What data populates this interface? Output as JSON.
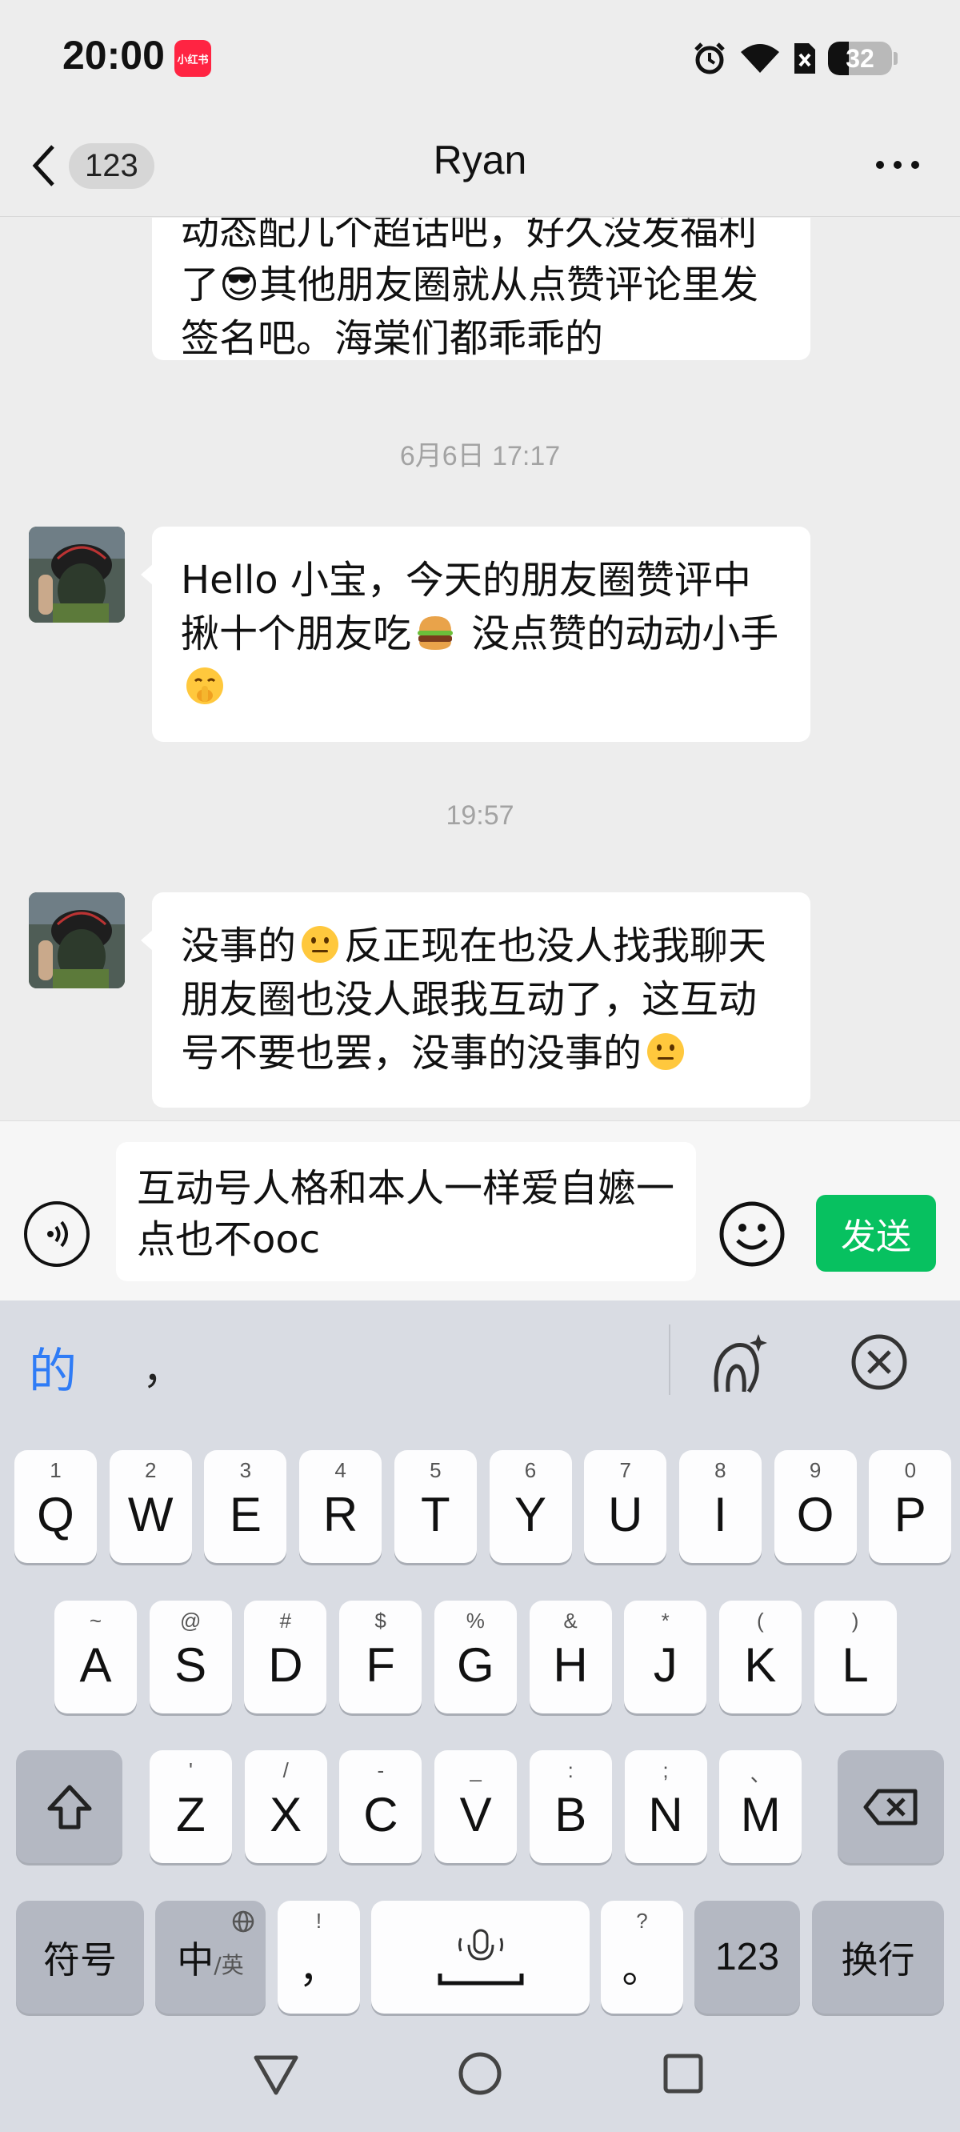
{
  "status_bar": {
    "time": "20:00",
    "app_badge": "小红书",
    "battery": "32",
    "battery_level": 0.32
  },
  "header": {
    "unread_count": "123",
    "title": "Ryan"
  },
  "messages": [
    {
      "type": "text",
      "lines": [
        "动态配几个超话吧，好久没发福利",
        "了😎其他朋友圈就从点赞评论里发",
        "签名吧。海棠们都乖乖的"
      ]
    },
    {
      "type": "time",
      "text": "6月6日 17:17"
    },
    {
      "type": "text",
      "part1": "Hello 小宝，今天的朋友圈赞评中揪十个朋友吃",
      "part2": " 没点赞的动动小手"
    },
    {
      "type": "time",
      "text": "19:57"
    },
    {
      "type": "text",
      "part1": "没事的",
      "part2": "反正现在也没人找我聊天朋友圈也没人跟我互动了，这互动号不要也罢，没事的没事的"
    }
  ],
  "input": {
    "value": "互动号人格和本人一样爱自嬷一点也不ooc",
    "send_label": "发送"
  },
  "keyboard": {
    "candidates": {
      "primary": "的",
      "secondary": "，"
    },
    "row1": [
      {
        "k": "Q",
        "s": "1"
      },
      {
        "k": "W",
        "s": "2"
      },
      {
        "k": "E",
        "s": "3"
      },
      {
        "k": "R",
        "s": "4"
      },
      {
        "k": "T",
        "s": "5"
      },
      {
        "k": "Y",
        "s": "6"
      },
      {
        "k": "U",
        "s": "7"
      },
      {
        "k": "I",
        "s": "8"
      },
      {
        "k": "O",
        "s": "9"
      },
      {
        "k": "P",
        "s": "0"
      }
    ],
    "row2": [
      {
        "k": "A",
        "s": "~"
      },
      {
        "k": "S",
        "s": "@"
      },
      {
        "k": "D",
        "s": "#"
      },
      {
        "k": "F",
        "s": "$"
      },
      {
        "k": "G",
        "s": "%"
      },
      {
        "k": "H",
        "s": "&"
      },
      {
        "k": "J",
        "s": "*"
      },
      {
        "k": "K",
        "s": "("
      },
      {
        "k": "L",
        "s": ")"
      }
    ],
    "row3": [
      {
        "k": "Z",
        "s": "'"
      },
      {
        "k": "X",
        "s": "/"
      },
      {
        "k": "C",
        "s": "-"
      },
      {
        "k": "V",
        "s": "_"
      },
      {
        "k": "B",
        "s": ":"
      },
      {
        "k": "N",
        "s": ";"
      },
      {
        "k": "M",
        "s": "、"
      }
    ],
    "symbols_label": "符号",
    "lang_main": "中",
    "lang_sub": "/英",
    "comma_top": "!",
    "comma_main": "，",
    "period_top": "?",
    "period_main": "。",
    "num_label": "123",
    "enter_label": "换行"
  },
  "colors": {
    "send_green": "#07c160",
    "candidate_blue": "#2f7cf6",
    "badge_red": "#ff2442"
  }
}
